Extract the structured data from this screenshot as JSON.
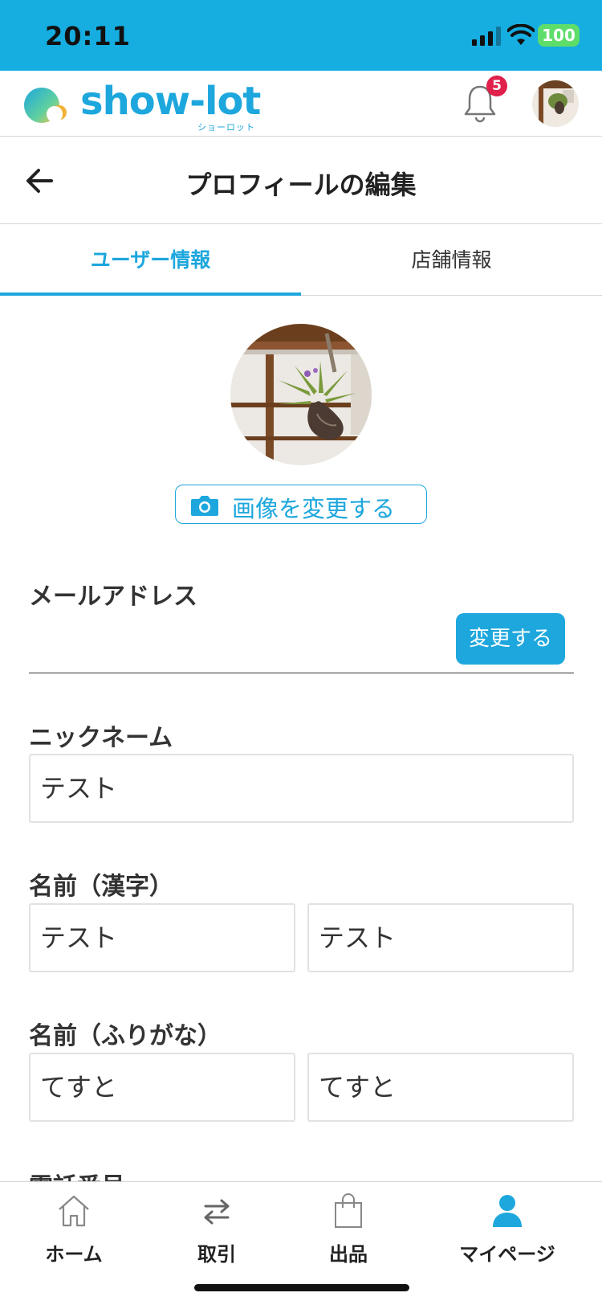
{
  "status_bar": {
    "time": "20:11",
    "battery": "100",
    "bg_color": "#16ade0"
  },
  "header": {
    "logo_text": "show-lot",
    "logo_sub": "ショーロット",
    "notification_count": "5",
    "brand_color": "#1da7dd",
    "badge_color": "#e0204a"
  },
  "title_bar": {
    "title": "プロフィールの編集"
  },
  "tabs": [
    {
      "label": "ユーザー情報",
      "active": true
    },
    {
      "label": "店舗情報",
      "active": false
    }
  ],
  "profile": {
    "change_image_label": "画像を変更する"
  },
  "form": {
    "email": {
      "label": "メールアドレス",
      "value": "",
      "change_button": "変更する"
    },
    "nickname": {
      "label": "ニックネーム",
      "value": "テスト"
    },
    "name_kanji": {
      "label": "名前（漢字）",
      "last": "テスト",
      "first": "テスト"
    },
    "name_kana": {
      "label": "名前（ふりがな）",
      "last": "てすと",
      "first": "てすと"
    },
    "phone": {
      "label": "電話番号"
    }
  },
  "bottom_nav": [
    {
      "label": "ホーム",
      "icon": "home-icon",
      "active": false
    },
    {
      "label": "取引",
      "icon": "exchange-icon",
      "active": false
    },
    {
      "label": "出品",
      "icon": "shopping-bag-icon",
      "active": false
    },
    {
      "label": "マイページ",
      "icon": "person-icon",
      "active": true
    }
  ]
}
